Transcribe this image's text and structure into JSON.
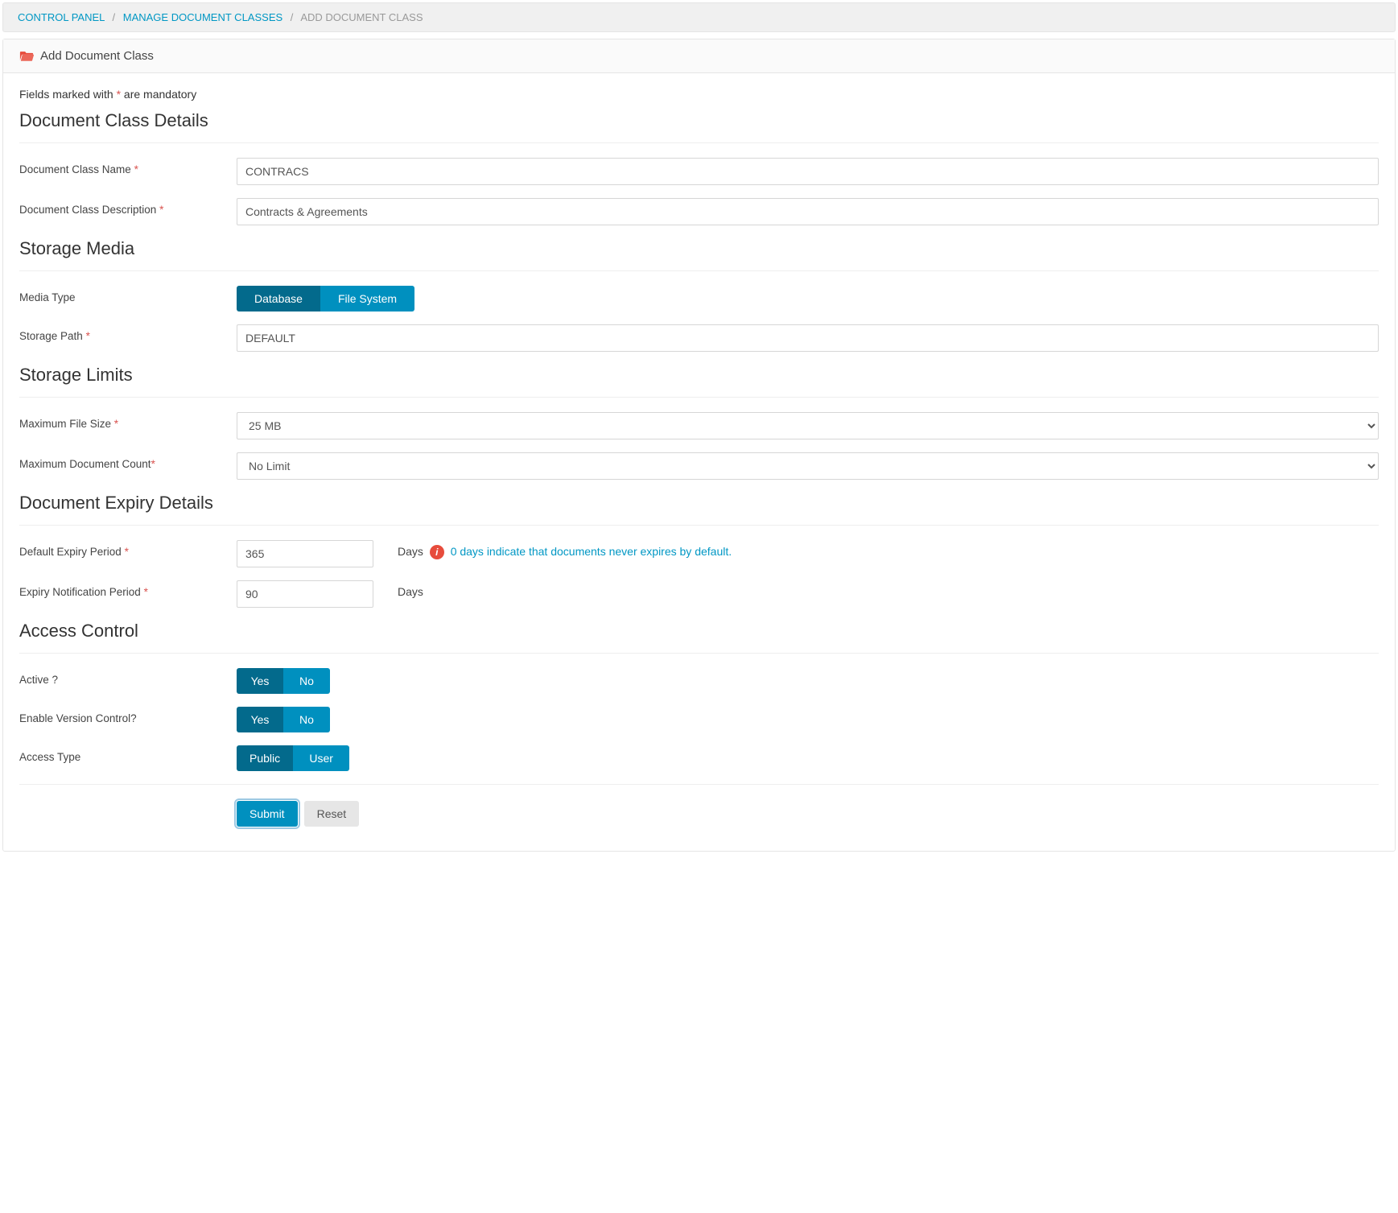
{
  "breadcrumb": {
    "items": [
      {
        "label": "CONTROL PANEL",
        "link": true
      },
      {
        "label": "MANAGE DOCUMENT CLASSES",
        "link": true
      },
      {
        "label": "ADD DOCUMENT CLASS",
        "link": false
      }
    ],
    "separator": "/"
  },
  "panel": {
    "title": "Add Document Class"
  },
  "mandatory_note": {
    "prefix": "Fields marked with ",
    "asterisk": "*",
    "suffix": " are mandatory"
  },
  "sections": {
    "details": {
      "title": "Document Class Details",
      "fields": {
        "name": {
          "label": "Document Class Name",
          "required": true,
          "value": "CONTRACS"
        },
        "desc": {
          "label": "Document Class Description",
          "required": true,
          "value": "Contracts & Agreements"
        }
      }
    },
    "storage_media": {
      "title": "Storage Media",
      "fields": {
        "media_type": {
          "label": "Media Type",
          "options": [
            "Database",
            "File System"
          ],
          "selected": 0
        },
        "storage_path": {
          "label": "Storage Path",
          "required": true,
          "value": "DEFAULT"
        }
      }
    },
    "storage_limits": {
      "title": "Storage Limits",
      "fields": {
        "max_file_size": {
          "label": "Maximum File Size",
          "required": true,
          "value": "25 MB"
        },
        "max_doc_count": {
          "label": "Maximum Document Count",
          "required": true,
          "value": "No Limit"
        }
      }
    },
    "expiry": {
      "title": "Document Expiry Details",
      "fields": {
        "default_period": {
          "label": "Default Expiry Period",
          "required": true,
          "value": "365",
          "unit": "Days",
          "help": "0 days indicate that documents never expires by default."
        },
        "notify_period": {
          "label": "Expiry Notification Period",
          "required": true,
          "value": "90",
          "unit": "Days"
        }
      }
    },
    "access": {
      "title": "Access Control",
      "fields": {
        "active": {
          "label": "Active ?",
          "options": [
            "Yes",
            "No"
          ],
          "selected": 0
        },
        "version": {
          "label": "Enable Version Control?",
          "options": [
            "Yes",
            "No"
          ],
          "selected": 0
        },
        "type": {
          "label": "Access Type",
          "options": [
            "Public",
            "User"
          ],
          "selected": 0
        }
      }
    }
  },
  "actions": {
    "submit": "Submit",
    "reset": "Reset"
  }
}
